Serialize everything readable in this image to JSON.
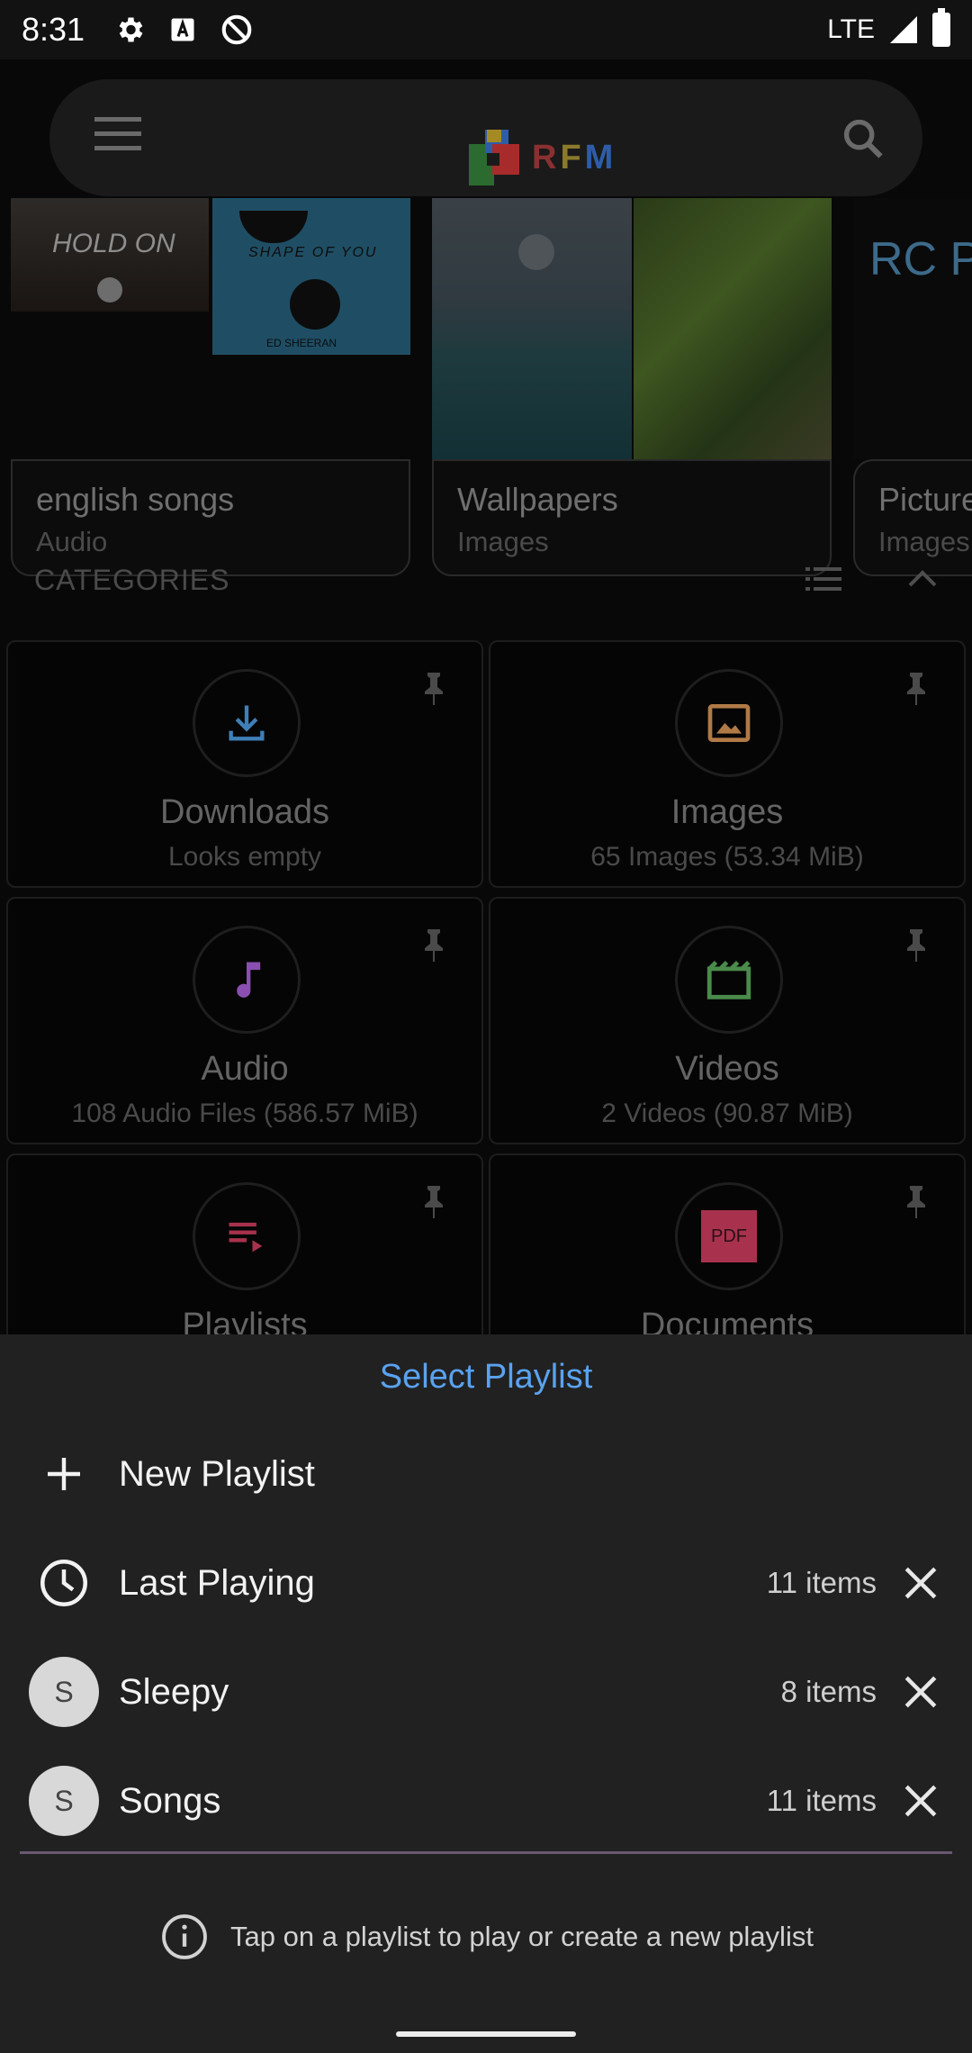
{
  "status_bar": {
    "time": "8:31",
    "network": "LTE",
    "icons": [
      "gear-icon",
      "a-icon",
      "sync-disabled-icon",
      "signal-icon",
      "battery-icon"
    ]
  },
  "app": {
    "logo_text": "RFM",
    "icons": [
      "menu-icon",
      "search-icon"
    ]
  },
  "albums": [
    {
      "title": "english songs",
      "subtitle": "Audio",
      "thumb_texts": [
        "HOLD ON",
        "SHAPE OF YOU",
        "ED SHEERAN"
      ]
    },
    {
      "title": "Wallpapers",
      "subtitle": "Images"
    },
    {
      "title": "Picture",
      "subtitle": "Images",
      "thumb_text": "RC P"
    }
  ],
  "categories": {
    "header": "CATEGORIES",
    "items": [
      {
        "name": "Downloads",
        "info": "Looks empty",
        "icon": "download-icon",
        "color": "#3f7fb8"
      },
      {
        "name": "Images",
        "info": "65 Images (53.34 MiB)",
        "icon": "image-icon",
        "color": "#b07a46"
      },
      {
        "name": "Audio",
        "info": "108 Audio Files (586.57 MiB)",
        "icon": "music-note-icon",
        "color": "#8a4fb0"
      },
      {
        "name": "Videos",
        "info": "2 Videos (90.87 MiB)",
        "icon": "video-icon",
        "color": "#4a8a4a"
      },
      {
        "name": "Playlists",
        "info": "",
        "icon": "playlist-icon",
        "color": "#a8324d"
      },
      {
        "name": "Documents",
        "info": "",
        "icon": "pdf-icon",
        "color": "#a8324d",
        "badge": "PDF"
      }
    ]
  },
  "sheet": {
    "title": "Select Playlist",
    "new_playlist": "New Playlist",
    "playlists": [
      {
        "name": "Last Playing",
        "count": "11 items",
        "icon": "clock-icon"
      },
      {
        "name": "Sleepy",
        "count": "8 items",
        "avatar": "S"
      },
      {
        "name": "Songs",
        "count": "11 items",
        "avatar": "S"
      }
    ],
    "hint": "Tap on a playlist to play or create a new playlist"
  }
}
